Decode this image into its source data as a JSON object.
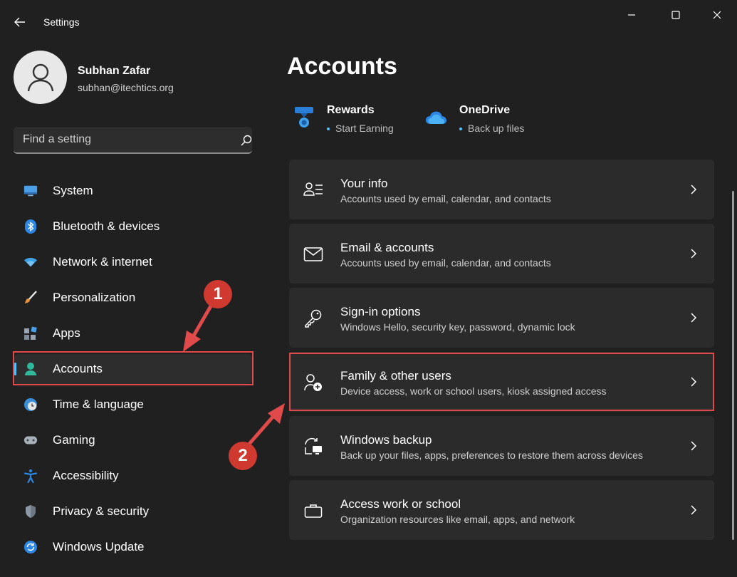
{
  "window": {
    "title": "Settings",
    "back_icon": "back-arrow-icon",
    "controls": {
      "minimize_icon": "minimize-icon",
      "maximize_icon": "maximize-icon",
      "close_icon": "close-icon"
    }
  },
  "profile": {
    "name": "Subhan Zafar",
    "email": "subhan@itechtics.org",
    "avatar_icon": "person-icon"
  },
  "search": {
    "placeholder": "Find a setting",
    "icon": "search-icon"
  },
  "sidebar": {
    "selected": "Accounts",
    "accent": "#4cc2ff",
    "items": [
      {
        "label": "System",
        "icon": "monitor-icon"
      },
      {
        "label": "Bluetooth & devices",
        "icon": "bluetooth-icon"
      },
      {
        "label": "Network & internet",
        "icon": "wifi-icon"
      },
      {
        "label": "Personalization",
        "icon": "brush-icon"
      },
      {
        "label": "Apps",
        "icon": "apps-icon"
      },
      {
        "label": "Accounts",
        "icon": "account-icon"
      },
      {
        "label": "Time & language",
        "icon": "clock-globe-icon"
      },
      {
        "label": "Gaming",
        "icon": "gamepad-icon"
      },
      {
        "label": "Accessibility",
        "icon": "accessibility-icon"
      },
      {
        "label": "Privacy & security",
        "icon": "shield-icon"
      },
      {
        "label": "Windows Update",
        "icon": "update-icon"
      }
    ]
  },
  "main": {
    "title": "Accounts",
    "quick_links": [
      {
        "title": "Rewards",
        "subtitle": "Start Earning",
        "icon": "rewards-medal-icon"
      },
      {
        "title": "OneDrive",
        "subtitle": "Back up files",
        "icon": "onedrive-cloud-icon"
      }
    ],
    "cards": [
      {
        "title": "Your info",
        "description": "Accounts used by email, calendar, and contacts",
        "icon": "person-list-icon"
      },
      {
        "title": "Email & accounts",
        "description": "Accounts used by email, calendar, and contacts",
        "icon": "mail-icon"
      },
      {
        "title": "Sign-in options",
        "description": "Windows Hello, security key, password, dynamic lock",
        "icon": "key-icon"
      },
      {
        "title": "Family & other users",
        "description": "Device access, work or school users, kiosk assigned access",
        "icon": "person-add-icon"
      },
      {
        "title": "Windows backup",
        "description": "Back up your files, apps, preferences to restore them across devices",
        "icon": "backup-icon"
      },
      {
        "title": "Access work or school",
        "description": "Organization resources like email, apps, and network",
        "icon": "briefcase-icon"
      }
    ]
  },
  "annotations": {
    "color": "#d0392f",
    "step1": "1",
    "step2": "2"
  }
}
